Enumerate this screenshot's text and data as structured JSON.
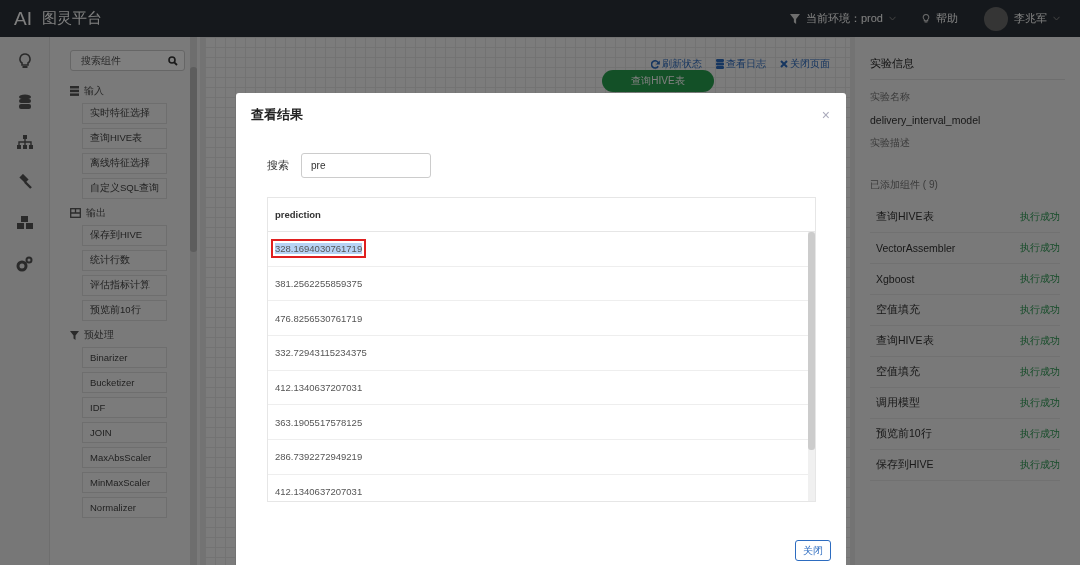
{
  "header": {
    "logo": "AI",
    "title": "图灵平台",
    "env_label": "当前环境：",
    "env_value": "prod",
    "help": "帮助",
    "user": "李兆军"
  },
  "component_panel": {
    "search_placeholder": "搜索组件",
    "groups": [
      {
        "name": "输入",
        "items": [
          "实时特征选择",
          "查询HIVE表",
          "离线特征选择",
          "自定义SQL查询"
        ]
      },
      {
        "name": "输出",
        "items": [
          "保存到HIVE",
          "统计行数",
          "评估指标计算",
          "预览前10行"
        ]
      },
      {
        "name": "预处理",
        "items": [
          "Binarizer",
          "Bucketizer",
          "IDF",
          "JOIN",
          "MaxAbsScaler",
          "MinMaxScaler",
          "Normalizer"
        ]
      }
    ]
  },
  "canvas": {
    "actions": [
      "刷新状态",
      "查看日志",
      "关闭页面"
    ],
    "node": "查询HIVE表"
  },
  "experiment_panel": {
    "title": "实验信息",
    "name_label": "实验名称",
    "name": "delivery_interval_model",
    "desc_label": "实验描述",
    "components_label": "已添加组件 ( 9)",
    "components": [
      {
        "name": "查询HIVE表",
        "status": "执行成功"
      },
      {
        "name": "VectorAssembler",
        "status": "执行成功"
      },
      {
        "name": "Xgboost",
        "status": "执行成功"
      },
      {
        "name": "空值填充",
        "status": "执行成功"
      },
      {
        "name": "查询HIVE表",
        "status": "执行成功"
      },
      {
        "name": "空值填充",
        "status": "执行成功"
      },
      {
        "name": "调用模型",
        "status": "执行成功"
      },
      {
        "name": "预览前10行",
        "status": "执行成功"
      },
      {
        "name": "保存到HIVE",
        "status": "执行成功"
      }
    ]
  },
  "dialog": {
    "title": "查看结果",
    "close": "×",
    "search_label": "搜索",
    "search_value": "pre",
    "table": {
      "columns": [
        "prediction"
      ],
      "rows": [
        {
          "prediction": "328.1694030761719",
          "selected": true
        },
        {
          "prediction": "381.2562255859375",
          "selected": false
        },
        {
          "prediction": "476.8256530761719",
          "selected": false
        },
        {
          "prediction": "332.72943115234375",
          "selected": false
        },
        {
          "prediction": "412.1340637207031",
          "selected": false
        },
        {
          "prediction": "363.1905517578125",
          "selected": false
        },
        {
          "prediction": "286.7392272949219",
          "selected": false
        },
        {
          "prediction": "412.1340637207031",
          "selected": false
        }
      ]
    },
    "buttons": [
      "关闭"
    ]
  }
}
